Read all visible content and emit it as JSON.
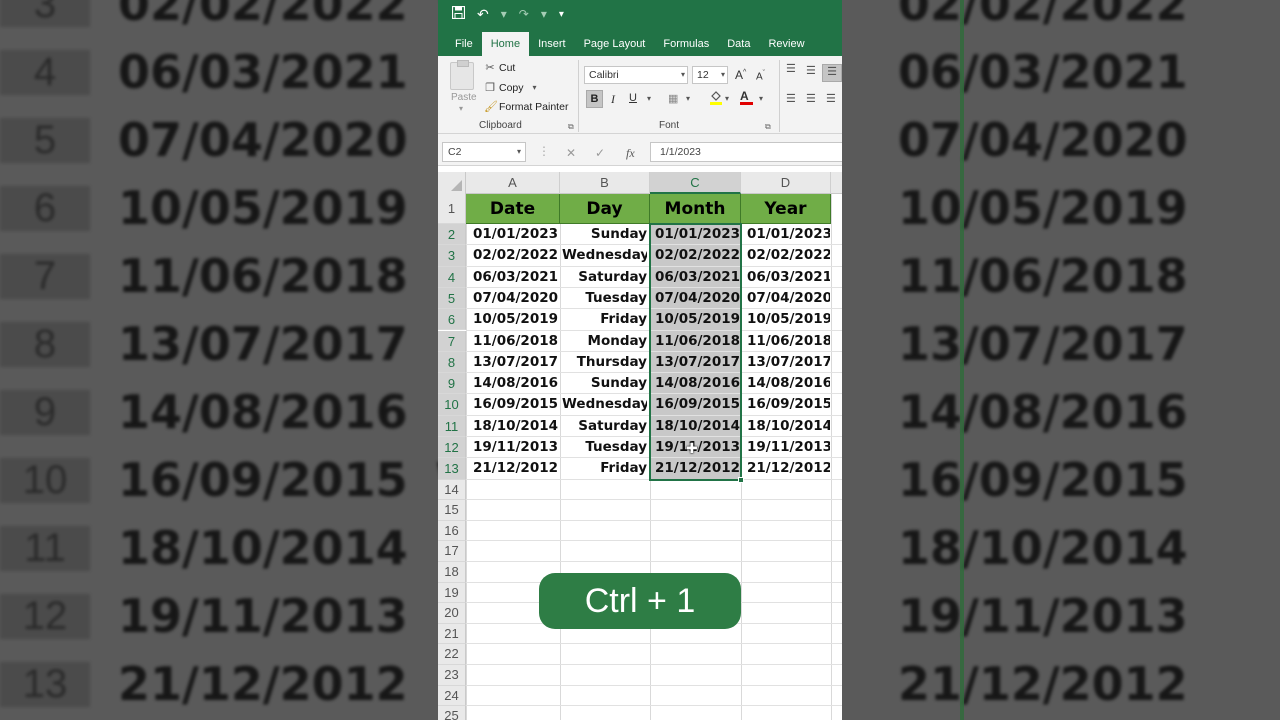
{
  "titlebar": {
    "qat_more": "▾"
  },
  "tabs": [
    {
      "label": "File",
      "active": false
    },
    {
      "label": "Home",
      "active": true
    },
    {
      "label": "Insert",
      "active": false
    },
    {
      "label": "Page Layout",
      "active": false
    },
    {
      "label": "Formulas",
      "active": false
    },
    {
      "label": "Data",
      "active": false
    },
    {
      "label": "Review",
      "active": false
    }
  ],
  "ribbon": {
    "clipboard": {
      "paste": "Paste",
      "cut": "Cut",
      "copy": "Copy",
      "format_painter": "Format Painter",
      "group_label": "Clipboard"
    },
    "font": {
      "name": "Calibri",
      "size": "12",
      "grow": "A",
      "shrink": "A",
      "bold": "B",
      "italic": "I",
      "underline": "U",
      "font_color_letter": "A",
      "group_label": "Font"
    }
  },
  "formula_bar": {
    "name_box": "C2",
    "cancel": "✕",
    "enter": "✓",
    "fx": "fx",
    "formula": "1/1/2023"
  },
  "columns": [
    "A",
    "B",
    "C",
    "D"
  ],
  "selected_column": "C",
  "headers": [
    "Date",
    "Day",
    "Month",
    "Year"
  ],
  "rows": [
    {
      "num": "2",
      "date": "01/01/2023",
      "day": "Sunday",
      "month": "01/01/2023",
      "year": "01/01/2023"
    },
    {
      "num": "3",
      "date": "02/02/2022",
      "day": "Wednesday",
      "month": "02/02/2022",
      "year": "02/02/2022"
    },
    {
      "num": "4",
      "date": "06/03/2021",
      "day": "Saturday",
      "month": "06/03/2021",
      "year": "06/03/2021"
    },
    {
      "num": "5",
      "date": "07/04/2020",
      "day": "Tuesday",
      "month": "07/04/2020",
      "year": "07/04/2020"
    },
    {
      "num": "6",
      "date": "10/05/2019",
      "day": "Friday",
      "month": "10/05/2019",
      "year": "10/05/2019"
    },
    {
      "num": "7",
      "date": "11/06/2018",
      "day": "Monday",
      "month": "11/06/2018",
      "year": "11/06/2018"
    },
    {
      "num": "8",
      "date": "13/07/2017",
      "day": "Thursday",
      "month": "13/07/2017",
      "year": "13/07/2017"
    },
    {
      "num": "9",
      "date": "14/08/2016",
      "day": "Sunday",
      "month": "14/08/2016",
      "year": "14/08/2016"
    },
    {
      "num": "10",
      "date": "16/09/2015",
      "day": "Wednesday",
      "month": "16/09/2015",
      "year": "16/09/2015"
    },
    {
      "num": "11",
      "date": "18/10/2014",
      "day": "Saturday",
      "month": "18/10/2014",
      "year": "18/10/2014"
    },
    {
      "num": "12",
      "date": "19/11/2013",
      "day": "Tuesday",
      "month": "19/11/2013",
      "year": "19/11/2013"
    },
    {
      "num": "13",
      "date": "21/12/2012",
      "day": "Friday",
      "month": "21/12/2012",
      "year": "21/12/2012"
    }
  ],
  "empty_rows": [
    "14",
    "15",
    "16",
    "17",
    "18",
    "19",
    "20",
    "21",
    "22",
    "23",
    "24",
    "25"
  ],
  "header_row_num": "1",
  "shortcut_badge": "Ctrl + 1",
  "background_left": [
    {
      "num": "3",
      "value": "02/02/2022",
      "extra": "W"
    },
    {
      "num": "4",
      "value": "06/03/2021",
      "extra": ""
    },
    {
      "num": "5",
      "value": "07/04/2020",
      "extra": ""
    },
    {
      "num": "6",
      "value": "10/05/2019",
      "extra": ""
    },
    {
      "num": "7",
      "value": "11/06/2018",
      "extra": ""
    },
    {
      "num": "8",
      "value": "13/07/2017",
      "extra": ""
    },
    {
      "num": "9",
      "value": "14/08/2016",
      "extra": ""
    },
    {
      "num": "10",
      "value": "16/09/2015",
      "extra": "W"
    },
    {
      "num": "11",
      "value": "18/10/2014",
      "extra": ""
    },
    {
      "num": "12",
      "value": "19/11/2013",
      "extra": ""
    },
    {
      "num": "13",
      "value": "21/12/2012",
      "extra": ""
    }
  ],
  "background_right": [
    {
      "a": "2022",
      "b": "02/02/2022"
    },
    {
      "a": "2021",
      "b": "06/03/2021"
    },
    {
      "a": "2020",
      "b": "07/04/2020"
    },
    {
      "a": "2019",
      "b": "10/05/2019"
    },
    {
      "a": "2018",
      "b": "11/06/2018"
    },
    {
      "a": "2017",
      "b": "13/07/2017"
    },
    {
      "a": "2016",
      "b": "14/08/2016"
    },
    {
      "a": "2015",
      "b": "16/09/2015"
    },
    {
      "a": "2014",
      "b": "18/10/2014"
    },
    {
      "a": "2013",
      "b": "19/11/2013"
    },
    {
      "a": "2012",
      "b": "21/12/2012"
    }
  ]
}
